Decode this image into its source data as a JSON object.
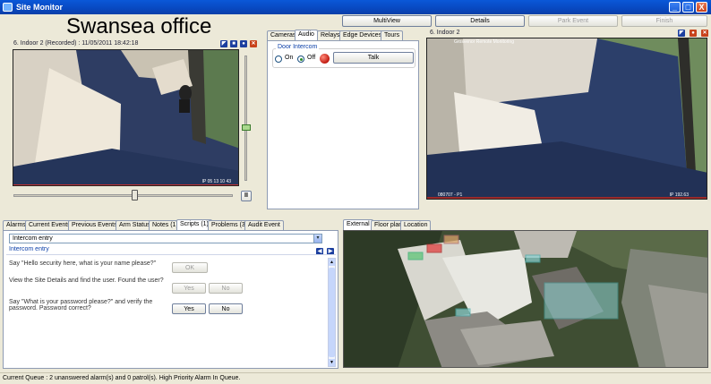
{
  "window": {
    "title": "Site Monitor",
    "minimize": "_",
    "maximize": "□",
    "close": "X"
  },
  "toolbar": {
    "multiview": "MultiView",
    "details": "Details",
    "park_event": "Park Event",
    "finish": "Finish"
  },
  "site": {
    "title": "Swansea office"
  },
  "left_camera": {
    "label": "6. Indoor 2 (Recorded) : 11/05/2011 18:42:18",
    "osd_bottom": "IP 05 13 10 43",
    "pause": "II"
  },
  "right_camera": {
    "label": "6. Indoor 2",
    "osd_top": "Grosvenor Remote Monitoring",
    "osd_bottom_left": "080707 - P1",
    "osd_bottom_right": "IP 192.63"
  },
  "center_tabs": [
    "Cameras",
    "Audio",
    "Relays",
    "Edge Devices",
    "Tours"
  ],
  "intercom": {
    "group_label": "Door Intercom",
    "on_label": "On",
    "off_label": "Off",
    "selected": "Off",
    "talk_button": "Talk"
  },
  "bottom_tabs": [
    "Alarms",
    "Current Events",
    "Previous Events",
    "Arm Status",
    "Notes (1)",
    "Scripts (1)",
    "Problems (3)",
    "Audit Event"
  ],
  "scripts": {
    "selected_script": "Intercom entry",
    "group_label": "Intercom entry",
    "steps": [
      {
        "text": "Say \"Hello security here, what is your name please?\"",
        "buttons": [
          "OK"
        ]
      },
      {
        "text": "View the Site Details and find the user. Found the user?",
        "buttons": [
          "Yes",
          "No"
        ]
      },
      {
        "text": "Say \"What is your password please?\" and verify the password. Password correct?",
        "buttons": [
          "Yes",
          "No"
        ]
      }
    ]
  },
  "map_tabs": [
    "External",
    "Floor plan",
    "Location"
  ],
  "status": {
    "text": "Current Queue : 2 unanswered alarm(s) and 0 patrol(s). High Priority Alarm In Queue."
  },
  "colors": {
    "titlebar": "#0848c0",
    "window_bg": "#ece9d8",
    "close_red": "#c8421b"
  }
}
